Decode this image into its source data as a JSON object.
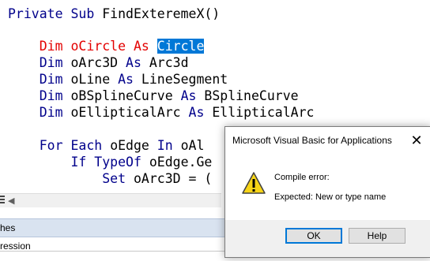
{
  "editor": {
    "line1": {
      "kw1": "Private",
      "kw2": "Sub",
      "rest": "FindExteremeX()"
    },
    "line2": {
      "kw1": "Dim",
      "var": "oCircle",
      "kw2": "As",
      "type": "Circle"
    },
    "line3": {
      "kw1": "Dim",
      "var": "oArc3D",
      "kw2": "As",
      "type": "Arc3d"
    },
    "line4": {
      "kw1": "Dim",
      "var": "oLine",
      "kw2": "As",
      "type": "LineSegment"
    },
    "line5": {
      "kw1": "Dim",
      "var": "oBSplineCurve",
      "kw2": "As",
      "type": "BSplineCurve"
    },
    "line6": {
      "kw1": "Dim",
      "var": "oEllipticalArc",
      "kw2": "As",
      "type": "EllipticalArc"
    },
    "line7": {
      "kw1": "For",
      "kw2": "Each",
      "var": "oEdge",
      "kw3": "In",
      "rest": "oAl"
    },
    "line8": {
      "kw1": "If",
      "kw2": "TypeOf",
      "rest": "oEdge.Ge"
    },
    "line9": {
      "kw1": "Set",
      "rest": "oArc3D = ("
    }
  },
  "immediate_panel": {
    "label": "hes"
  },
  "watch_panel": {
    "column": "ression"
  },
  "dialog": {
    "title": "Microsoft Visual Basic for Applications",
    "close_glyph": "✕",
    "message_1": "Compile error:",
    "message_2": "Expected: New or type name",
    "ok_label": "OK",
    "help_label": "Help"
  },
  "colors": {
    "keyword": "#00008b",
    "error_line": "#e30000",
    "selection": "#0078d7",
    "warning": "#f7d417"
  }
}
